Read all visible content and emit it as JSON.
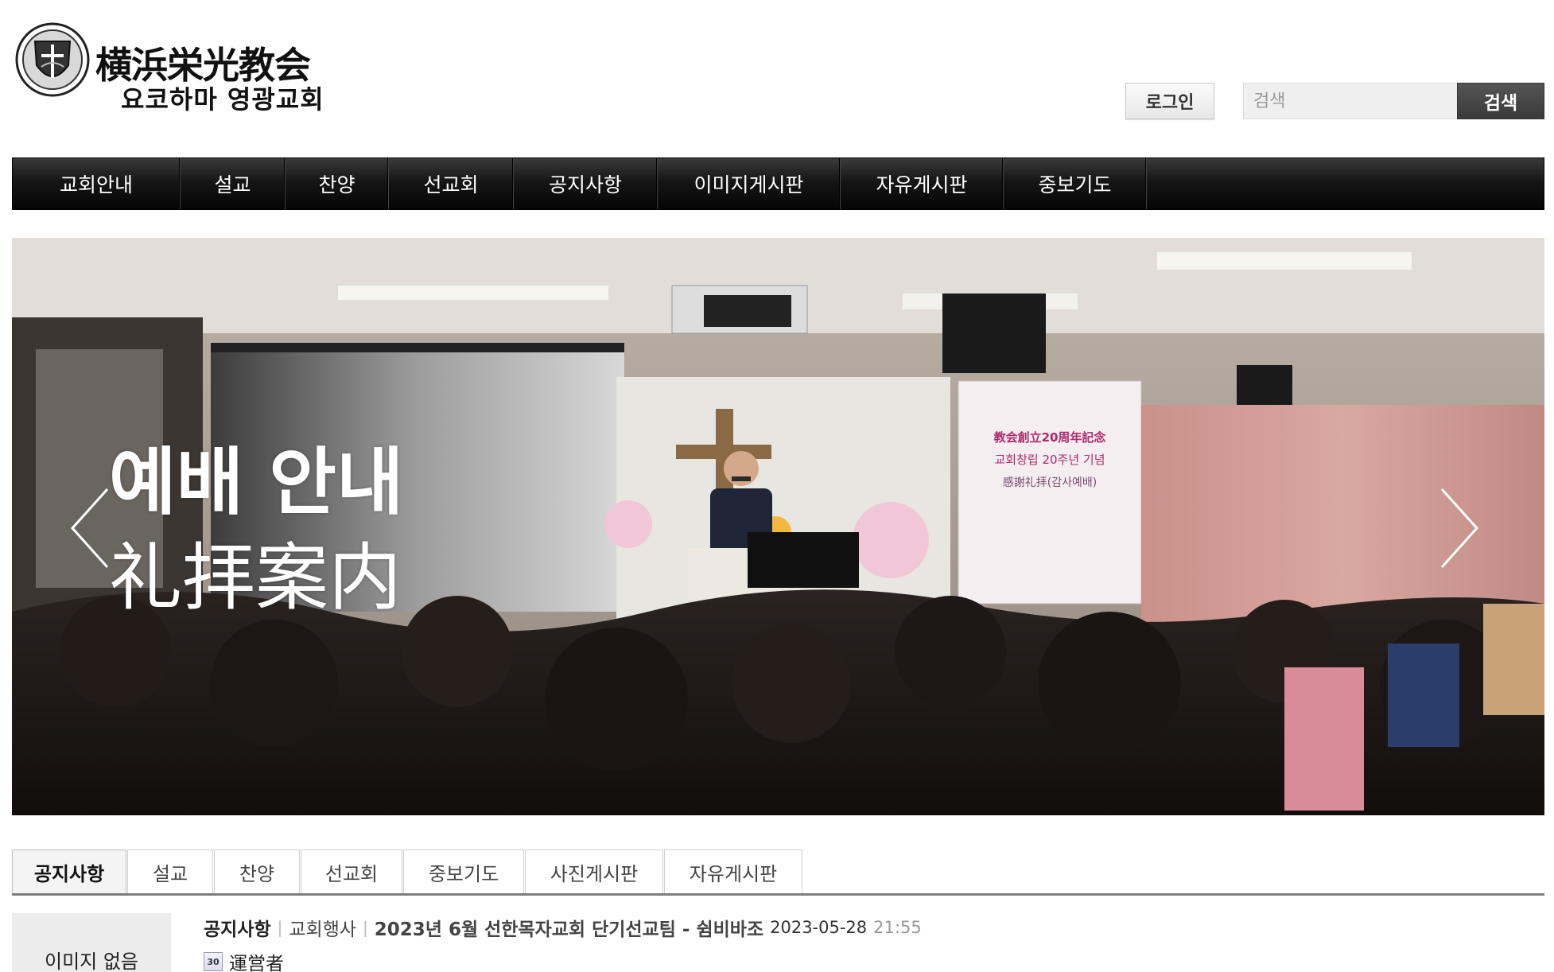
{
  "header": {
    "logo_jp": "横浜栄光教会",
    "logo_ko": "요코하마 영광교회",
    "login_label": "로그인",
    "search_placeholder": "검색",
    "search_button": "검색"
  },
  "nav": {
    "items": [
      "교회안내",
      "설교",
      "찬양",
      "선교회",
      "공지사항",
      "이미지게시판",
      "자유게시판",
      "중보기도"
    ]
  },
  "hero": {
    "title_line1": "예배 안내",
    "title_line2": "礼拝案内",
    "banner_line1": "教会創立20周年記念",
    "banner_line2": "교회창립 20주년 기념",
    "banner_line3": "感謝礼拝(감사예배)"
  },
  "tabs": {
    "items": [
      "공지사항",
      "설교",
      "찬양",
      "선교회",
      "중보기도",
      "사진게시판",
      "자유게시판"
    ],
    "active": "공지사항"
  },
  "latest_post": {
    "thumbnail_text": "이미지 없음",
    "board": "공지사항",
    "category": "교회행사",
    "title": "2023년 6월 선한목자교회 단기선교팀 - 쉼비바조",
    "date": "2023-05-28",
    "time": "21:55",
    "level_badge": "30",
    "author": "運営者"
  },
  "colors": {
    "nav_bg": "#111111",
    "search_button_bg": "#444444",
    "tab_underline": "#7d7d7d"
  }
}
